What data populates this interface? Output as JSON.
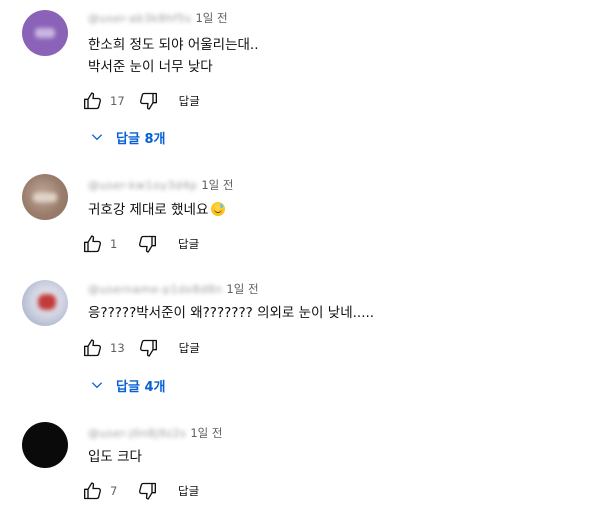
{
  "comments": [
    {
      "author": "@user-ab3k8hf5s",
      "time": "1일 전",
      "lines": [
        "한소희 정도 되야 어울리는대..",
        "박서준 눈이 너무 낮다"
      ],
      "likes": "17",
      "reply_label": "답글",
      "replies_label": "답글 8개"
    },
    {
      "author": "@user-kw1oy3d4p",
      "time": "1일 전",
      "lines": [
        "귀호강 제대로 했네요"
      ],
      "likes": "1",
      "reply_label": "답글"
    },
    {
      "author": "@username-p1dx8d8n",
      "time": "1일 전",
      "lines": [
        "응?????박서준이 왜??????? 의외로 눈이 낮네....."
      ],
      "likes": "13",
      "reply_label": "답글",
      "replies_label": "답글 4개"
    },
    {
      "author": "@user-j0n8j9z2s",
      "time": "1일 전",
      "lines": [
        "입도 크다"
      ],
      "likes": "7",
      "reply_label": "답글"
    }
  ],
  "icons": {
    "like": "thumbs-up-icon",
    "dislike": "thumbs-down-icon",
    "expand": "chevron-down-icon"
  },
  "colors": {
    "link_blue": "#065fd4",
    "secondary_text": "#606060",
    "primary_text": "#0f0f0f"
  }
}
